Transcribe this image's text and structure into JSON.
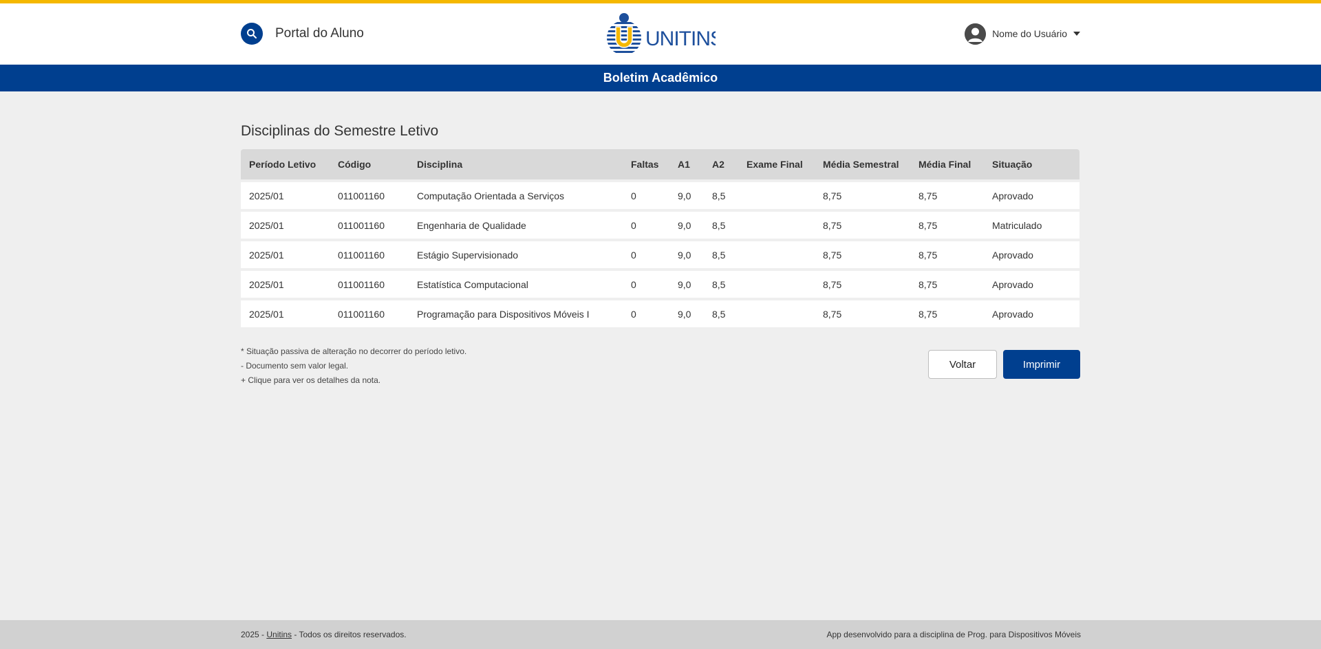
{
  "header": {
    "portal_title": "Portal do Aluno",
    "logo_text": "UNITINS",
    "user_name": "Nome do Usuário"
  },
  "subbar": {
    "title": "Boletim Acadêmico"
  },
  "section": {
    "title": "Disciplinas do Semestre Letivo"
  },
  "table": {
    "headers": [
      "Período Letivo",
      "Código",
      "Disciplina",
      "Faltas",
      "A1",
      "A2",
      "Exame Final",
      "Média Semestral",
      "Média Final",
      "Situação"
    ],
    "rows": [
      [
        "2025/01",
        "011001160",
        "Computação Orientada a Serviços",
        "0",
        "9,0",
        "8,5",
        "",
        "8,75",
        "8,75",
        "Aprovado"
      ],
      [
        "2025/01",
        "011001160",
        "Engenharia de Qualidade",
        "0",
        "9,0",
        "8,5",
        "",
        "8,75",
        "8,75",
        "Matriculado"
      ],
      [
        "2025/01",
        "011001160",
        "Estágio Supervisionado",
        "0",
        "9,0",
        "8,5",
        "",
        "8,75",
        "8,75",
        "Aprovado"
      ],
      [
        "2025/01",
        "011001160",
        "Estatística Computacional",
        "0",
        "9,0",
        "8,5",
        "",
        "8,75",
        "8,75",
        "Aprovado"
      ],
      [
        "2025/01",
        "011001160",
        "Programação para Dispositivos Móveis I",
        "0",
        "9,0",
        "8,5",
        "",
        "8,75",
        "8,75",
        "Aprovado"
      ]
    ]
  },
  "notes": [
    "* Situação passiva de alteração no decorrer do período letivo.",
    "- Documento sem valor legal.",
    "+ Clique para ver os detalhes da nota."
  ],
  "actions": {
    "back_label": "Voltar",
    "print_label": "Imprimir"
  },
  "footer": {
    "left_prefix": "2025 - ",
    "left_link": "Unitins",
    "left_suffix": " - Todos os direitos reservados.",
    "right": "App desenvolvido para a disciplina de Prog. para Dispositivos Móveis"
  },
  "colors": {
    "accent": "#f5b800",
    "brand": "#003f8f",
    "background": "#efefef",
    "footer": "#d1d1d1"
  },
  "icons": {
    "search": "search-icon",
    "user": "user-avatar-icon",
    "dropdown": "chevron-down-icon"
  }
}
